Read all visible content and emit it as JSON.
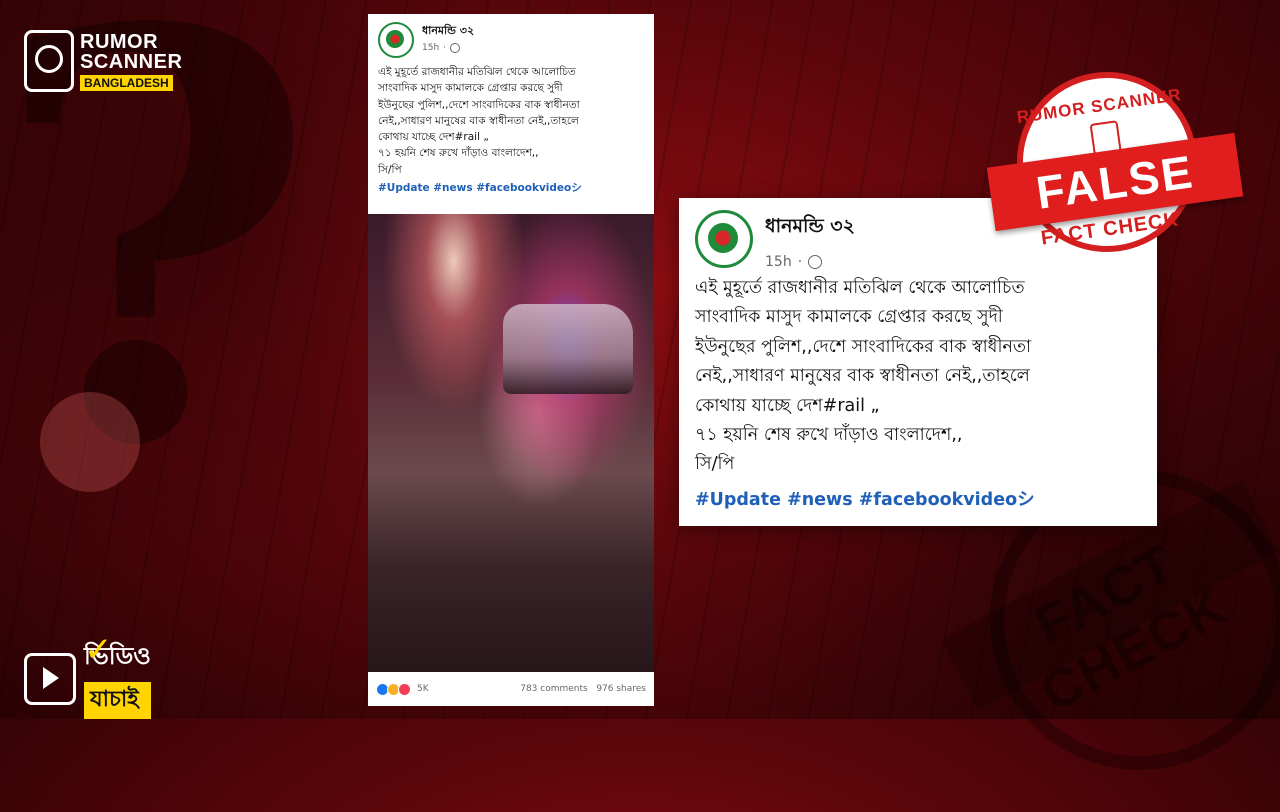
{
  "logo": {
    "line1": "RUMOR",
    "line2": "SCANNER",
    "line3": "BANGLADESH"
  },
  "badge": {
    "word1": "ভিডিও",
    "word2": "যাচাই"
  },
  "post": {
    "author": "ধানমন্ডি ৩২",
    "time": "15h",
    "lines": [
      "এই মুহূর্তে রাজধানীর মতিঝিল থেকে আলোচিত",
      "সাংবাদিক মাসুদ কামালকে গ্রেপ্তার করছে সুদী",
      "ইউনুছের পুলিশ,,দেশে সাংবাদিকের বাক স্বাধীনতা",
      "নেই,,সাধারণ মানুষের বাক স্বাধীনতা নেই,,তাহলে",
      "কোথায় যাচ্ছে দেশ#rail „",
      "৭১ হয়নি শেষ রুখে দাঁড়াও বাংলাদেশ,,",
      "সি/পি"
    ],
    "hashtags": "#Update #news #facebookvideoシ",
    "reactions": "5K",
    "comments": "783 comments",
    "shares": "976 shares"
  },
  "zoomed_post": {
    "author": "ধানমন্ডি ৩২",
    "time": "15h",
    "lines": [
      "এই মুহূর্তে রাজধানীর মতিঝিল থেকে আলোচিত",
      "সাংবাদিক মাসুদ কামালকে গ্রেপ্তার করছে সুদী",
      "ইউনুছের পুলিশ,,দেশে সাংবাদিকের বাক স্বাধীনতা",
      "নেই,,সাধারণ মানুষের বাক স্বাধীনতা নেই,,তাহলে",
      "কোথায় যাচ্ছে দেশ#rail „",
      "৭১ হয়নি শেষ রুখে দাঁড়াও বাংলাদেশ,,",
      "সি/পি"
    ],
    "hashtags": "#Update #news #facebookvideoシ"
  },
  "stamp": {
    "top": "RUMOR SCANNER",
    "verdict": "FALSE",
    "bottom": "FACT CHECK"
  },
  "background_stamp": {
    "text": "FACT CHECK"
  },
  "colors": {
    "accent_red": "#d31f1f",
    "brand_yellow": "#ffd400",
    "hashtag_blue": "#1f5fb8"
  }
}
